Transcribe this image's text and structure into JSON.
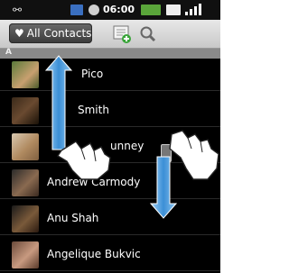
{
  "status_bar": {
    "time": "06:00",
    "usb_icon": "usb-icon",
    "keyboard_icon": "abc-keyboard-icon",
    "alarm_icon": "alarm-icon",
    "battery_icon": "battery-icon",
    "signal_icon": "signal-icon"
  },
  "toolbar": {
    "filter_label": "All Contacts",
    "filter_icon": "heart-icon",
    "add_icon": "add-contact-icon",
    "search_icon": "search-icon"
  },
  "section_letter": "A",
  "contacts": [
    {
      "name": "Pico"
    },
    {
      "name": "Smith"
    },
    {
      "name": "unney"
    },
    {
      "name": "Andrew Carmody"
    },
    {
      "name": "Anu Shah"
    },
    {
      "name": "Angelique Bukvic"
    }
  ],
  "colors": {
    "status_bar": "#101010",
    "toolbar": "#d8d8d8",
    "list_bg": "#000000",
    "arrow_blue": "#3b8fd6"
  }
}
